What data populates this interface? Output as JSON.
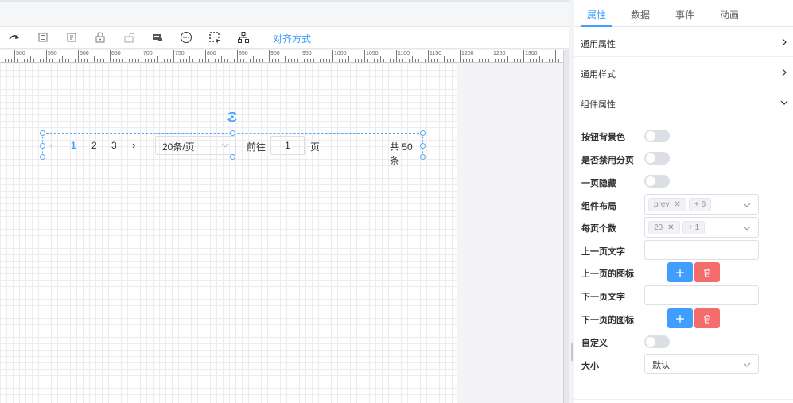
{
  "toolbar": {
    "align_label": "对齐方式",
    "icons": [
      "redo-icon",
      "copy-icon",
      "paste-icon",
      "lock-icon",
      "unlock-icon",
      "preview-icon",
      "more-icon",
      "select-area-icon",
      "hierarchy-icon"
    ]
  },
  "ruler": {
    "labels": [
      "500",
      "550",
      "600",
      "650",
      "700",
      "750",
      "800",
      "850",
      "900",
      "950",
      "1000",
      "1050",
      "1100",
      "1150",
      "1200",
      "1250",
      "1300"
    ]
  },
  "pagination": {
    "prev": "‹",
    "pages": [
      "1",
      "2",
      "3"
    ],
    "next": "›",
    "page_size": "20条/页",
    "goto": "前往",
    "jump_value": "1",
    "page_suffix": "页",
    "total": "共 50 条"
  },
  "panel": {
    "tabs": [
      "属性",
      "数据",
      "事件",
      "动画"
    ],
    "active_tab": "属性",
    "sections": {
      "common_props": "通用属性",
      "common_styles": "通用样式",
      "component_props": "组件属性"
    },
    "rows": {
      "button_bg": "按钮背景色",
      "disable_paging": "是否禁用分页",
      "hide_single": "一页隐藏",
      "layout": "组件布局",
      "page_size": "每页个数",
      "prev_text": "上一页文字",
      "prev_icon": "上一页的图标",
      "next_text": "下一页文字",
      "next_icon": "下一页的图标",
      "custom": "自定义",
      "size": "大小"
    },
    "layout_tags": [
      "prev",
      "+ 6"
    ],
    "page_size_tags": [
      "20",
      "+ 1"
    ],
    "size_value": "默认"
  },
  "colors": {
    "accent": "#409eff",
    "danger": "#f56c6c"
  }
}
